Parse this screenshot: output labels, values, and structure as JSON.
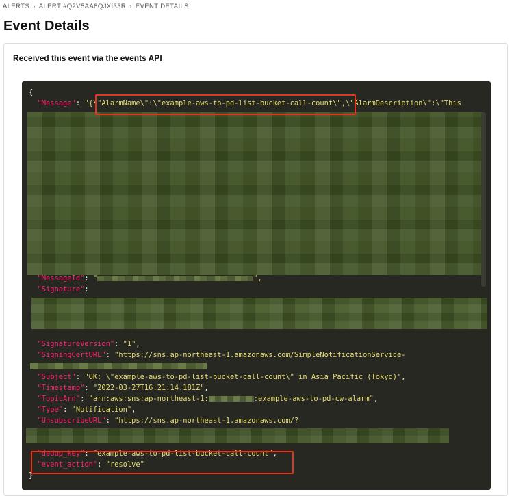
{
  "breadcrumb": {
    "items": [
      "ALERTS",
      "ALERT #Q2V5AA8QJXI33R",
      "EVENT DETAILS"
    ],
    "separator": "›"
  },
  "page": {
    "title": "Event Details"
  },
  "panel": {
    "heading": "Received this event via the events API"
  },
  "code": {
    "open_brace": "{",
    "close_brace": "}",
    "message_key": "\"Message\"",
    "message_colon": ": ",
    "message_val_start": "\"{",
    "alarm_name_part": "\\\"AlarmName\\\":\\\"example-aws-to-pd-list-bucket-call-count\\\",",
    "alarm_desc_part": "\\\"AlarmDescription\\\":\\\"This",
    "message_id_key": "\"MessageId\"",
    "message_id_open": "\"",
    "message_id_close": "\",",
    "signature_key": "\"Signature\"",
    "signature_colon": ":",
    "sig_version_key": "\"SignatureVersion\"",
    "sig_version_val": "\"1\"",
    "cert_url_key": "\"SigningCertURL\"",
    "cert_url_val": "\"https://sns.ap-northeast-1.amazonaws.com/SimpleNotificationService-",
    "subject_key": "\"Subject\"",
    "subject_val": "\"OK: \\\"example-aws-to-pd-list-bucket-call-count\\\" in Asia Pacific (Tokyo)\"",
    "timestamp_key": "\"Timestamp\"",
    "timestamp_val": "\"2022-03-27T16:21:14.181Z\"",
    "topic_key": "\"TopicArn\"",
    "topic_val_start": "\"arn:aws:sns:ap-northeast-1:",
    "topic_val_end": ":example-aws-to-pd-cw-alarm\"",
    "type_key": "\"Type\"",
    "type_val": "\"Notification\"",
    "unsub_key": "\"UnsubscribeURL\"",
    "unsub_val": "\"https://sns.ap-northeast-1.amazonaws.com/?",
    "dedup_key": "\"dedup_key\"",
    "dedup_val": "\"example-aws-to-pd-list-bucket-call-count\"",
    "event_action_key": "\"event_action\"",
    "event_action_val": "\"resolve\"",
    "colon": ": ",
    "comma": ","
  },
  "colors": {
    "code_bg": "#272822",
    "key": "#f92672",
    "string": "#e6db74",
    "punct": "#f8f8f2",
    "annotation": "#e8331c",
    "redaction_green": "#3f5224"
  }
}
